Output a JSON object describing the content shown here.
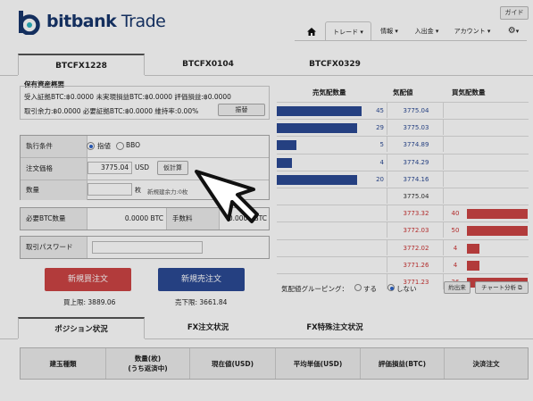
{
  "header": {
    "brand_bold": "bitbank",
    "brand_light": " Trade",
    "guide_label": "ガイド",
    "nav": [
      {
        "label": "トレード ▾"
      },
      {
        "label": "情報 ▾"
      },
      {
        "label": "入出金 ▾"
      },
      {
        "label": "アカウント ▾"
      },
      {
        "label": "▾"
      }
    ]
  },
  "pair_tabs": [
    "BTCFX1228",
    "BTCFX0104",
    "BTCFX0329"
  ],
  "summary": {
    "title": "保有資産概要",
    "line1": "受入証拠BTC:฿0.0000   未実現損益BTC:฿0.0000   評価損益:฿0.0000",
    "line2": "取引余力:฿0.0000   必要証拠BTC:฿0.0000   維持率:0.00%",
    "transfer_label": "振替"
  },
  "order": {
    "cond_label": "執行条件",
    "opt_limit": "指値",
    "opt_bbo": "BBO",
    "price_label": "注文価格",
    "price_value": "3775.04",
    "price_unit": "USD",
    "calc_label": "仮計算",
    "qty_label": "数量",
    "qty_unit": "枚",
    "new_limit": "新規建余力:0枚",
    "margin_label": "必要BTC数量",
    "margin_value": "0.0000 BTC",
    "fee_label": "手数料",
    "fee_value": "0.0000 BTC",
    "password_label": "取引パスワード",
    "buy_label": "新規買注文",
    "sell_label": "新規売注文",
    "buy_limit": "買上限: 3889.06",
    "sell_limit": "売下限: 3661.84"
  },
  "orderbook": {
    "head_sell": "売気配数量",
    "head_price": "気配値",
    "head_buy": "買気配数量",
    "asks": [
      {
        "qty": "45",
        "price": "3775.04",
        "fill": 0.77
      },
      {
        "qty": "29",
        "price": "3775.03",
        "fill": 0.73
      },
      {
        "qty": "5",
        "price": "3774.89",
        "fill": 0.18
      },
      {
        "qty": "4",
        "price": "3774.29",
        "fill": 0.14
      },
      {
        "qty": "20",
        "price": "3774.16",
        "fill": 0.73
      }
    ],
    "mid_price": "3775.04",
    "bids": [
      {
        "qty": "40",
        "price": "3773.32",
        "fill": 0.98
      },
      {
        "qty": "50",
        "price": "3772.03",
        "fill": 0.98
      },
      {
        "qty": "4",
        "price": "3772.02",
        "fill": 0.2
      },
      {
        "qty": "4",
        "price": "3771.26",
        "fill": 0.2
      },
      {
        "qty": "26",
        "price": "3771.23",
        "fill": 0.98
      }
    ],
    "grouping_label": "気配値グルーピング：",
    "grouping_yes": "する",
    "grouping_no": "しない",
    "history_label": "約出来",
    "chart_label": "チャート分析 ⧉"
  },
  "bottom_tabs": [
    "ポジション状況",
    "FX注文状況",
    "FX特殊注文状況"
  ],
  "table_headers": [
    "建玉種類",
    "数量(枚)\n(うち返済中)",
    "現在値(USD)",
    "平均単価(USD)",
    "評価損益(BTC)",
    "決済注文"
  ],
  "colors": {
    "brand": "#17366c",
    "buy": "#cc4444",
    "sell": "#2b4a94"
  }
}
